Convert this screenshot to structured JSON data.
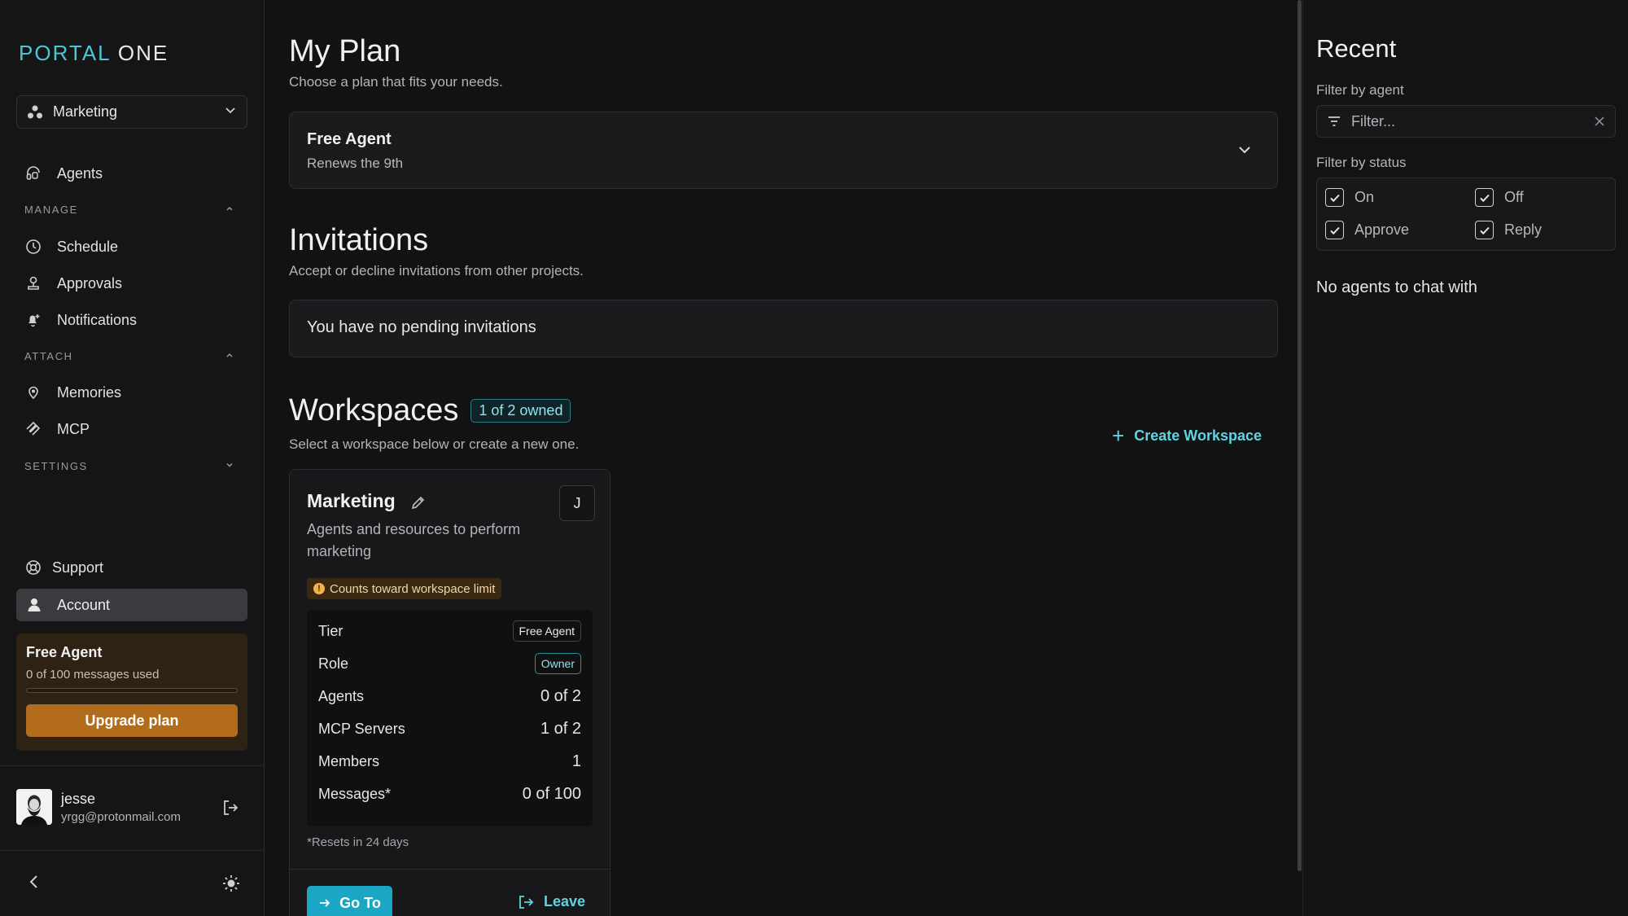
{
  "sidebar": {
    "logo_part1": "PORTAL",
    "logo_part2": " ONE",
    "workspace_select": "Marketing",
    "agents": "Agents",
    "manage": "MANAGE",
    "schedule": "Schedule",
    "approvals": "Approvals",
    "notifications": "Notifications",
    "attach": "ATTACH",
    "memories": "Memories",
    "mcp": "MCP",
    "settings": "SETTINGS",
    "support": "Support",
    "account": "Account",
    "plan_card": {
      "title": "Free Agent",
      "usage": "0 of 100 messages used",
      "usage_fraction": 0,
      "upgrade": "Upgrade plan"
    },
    "user": {
      "name": "jesse",
      "email": "yrgg@protonmail.com"
    }
  },
  "main": {
    "plan": {
      "title": "My Plan",
      "subtitle": "Choose a plan that fits your needs.",
      "current": "Free Agent",
      "renews": "Renews the 9th"
    },
    "invitations": {
      "title": "Invitations",
      "subtitle": "Accept or decline invitations from other projects.",
      "empty": "You have no pending invitations"
    },
    "workspaces": {
      "title": "Workspaces",
      "badge": "1 of 2 owned",
      "subtitle": "Select a workspace below or create a new one.",
      "create": "Create Workspace",
      "card": {
        "name": "Marketing",
        "letter": "J",
        "description": "Agents and resources to perform marketing",
        "warning": "Counts toward workspace limit",
        "stats": [
          {
            "label": "Tier",
            "value": "Free Agent"
          },
          {
            "label": "Role",
            "value": "Owner"
          },
          {
            "label": "Agents",
            "value": "0 of 2"
          },
          {
            "label": "MCP Servers",
            "value": "1 of 2"
          },
          {
            "label": "Members",
            "value": "1"
          },
          {
            "label": "Messages*",
            "value": "0 of 100"
          }
        ],
        "reset_note": "*Resets in 24 days",
        "goto": "Go To",
        "leave": "Leave"
      }
    }
  },
  "right": {
    "title": "Recent",
    "filter_agent_label": "Filter by agent",
    "filter_placeholder": "Filter...",
    "filter_status_label": "Filter by status",
    "statuses": [
      "On",
      "Off",
      "Approve",
      "Reply"
    ],
    "empty": "No agents to chat with"
  },
  "colors": {
    "accent": "#48c7d6",
    "upgrade": "#b36b1c",
    "goto": "#1aa6c4"
  }
}
